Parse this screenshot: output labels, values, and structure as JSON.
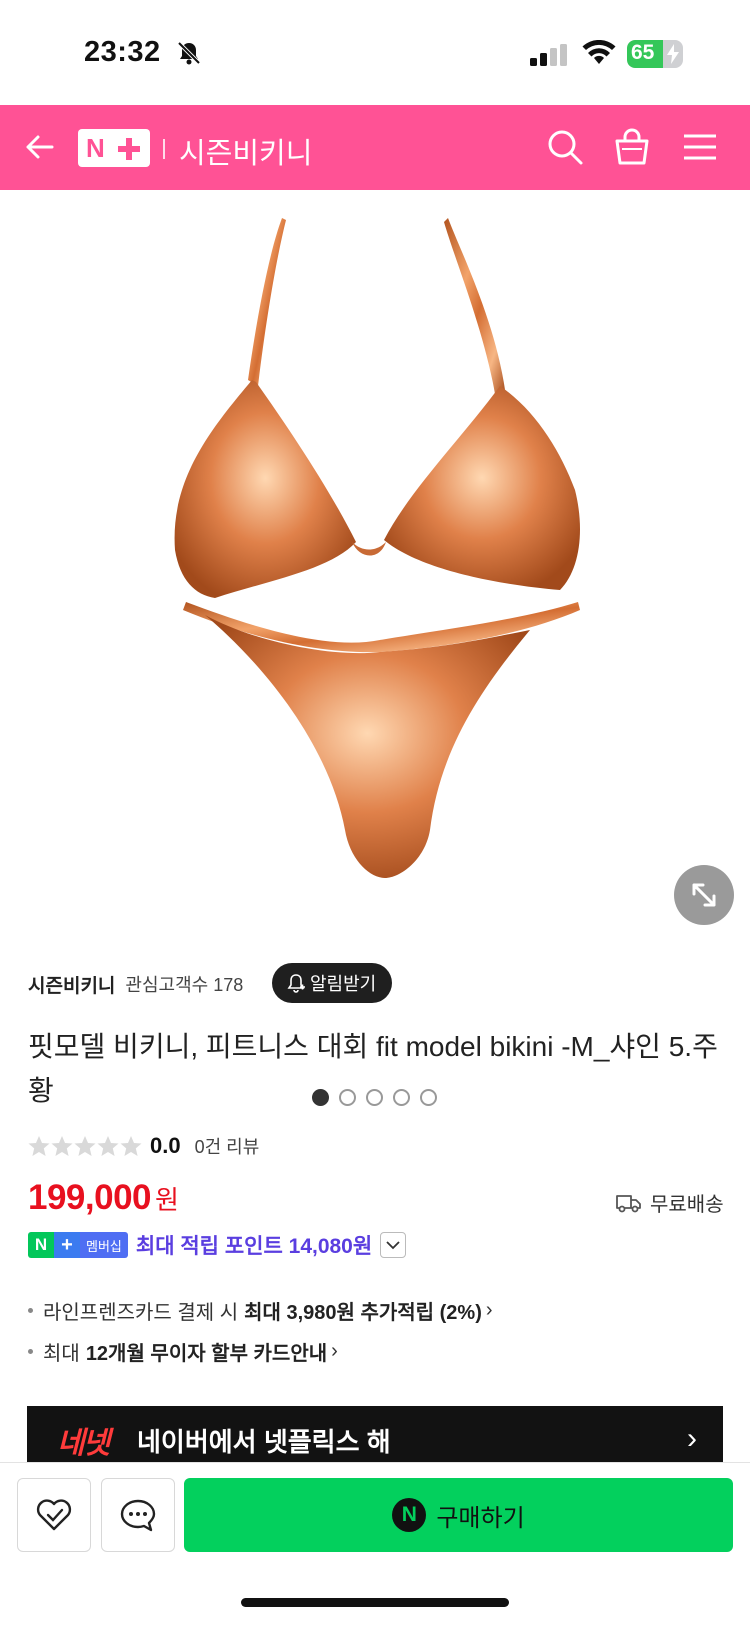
{
  "status": {
    "time": "23:32",
    "battery": "65",
    "battery_level": 0.65
  },
  "header": {
    "store_title": "시즌비키니"
  },
  "gallery": {
    "dot_count": 5,
    "active_index": 0
  },
  "store": {
    "name": "시즌비키니",
    "followers": "관심고객수 178",
    "alarm_label": "알림받기"
  },
  "product": {
    "title": "핏모델 비키니, 피트니스 대회 fit model bikini -M_샤인 5.주황"
  },
  "rating": {
    "score": "0.0",
    "stars": 0,
    "reviews": "0건 리뷰"
  },
  "price": {
    "amount": "199,000",
    "unit": "원",
    "shipping": "무료배송"
  },
  "points": {
    "badge_n": "N",
    "badge_plus": "+",
    "badge_member": "멤버십",
    "text": "최대 적립 포인트 14,080원"
  },
  "benefits": [
    {
      "prefix": "라인프렌즈카드 결제 시",
      "bold": "최대 3,980원 추가적립 (2%)",
      "chevron": "›"
    },
    {
      "prefix": "최대",
      "bold": "12개월 무이자 할부 카드안내",
      "chevron": "›"
    }
  ],
  "banner": {
    "logo": "네넷",
    "text": "네이버에서 넷플릭스 해",
    "chevron": "›"
  },
  "bottom": {
    "buy_badge": "N",
    "buy_label": "구매하기"
  },
  "colors": {
    "brand_pink": "#ff5295",
    "price_red": "#e8101f",
    "points_purple": "#5a3ee0",
    "buy_green": "#03d05d",
    "bikini_orange": "#d9723a"
  }
}
